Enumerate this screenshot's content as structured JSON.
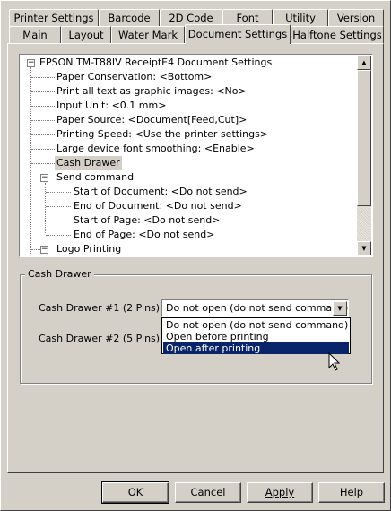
{
  "tabs_row1": [
    "Printer Settings",
    "Barcode",
    "2D Code",
    "Font",
    "Utility",
    "Version"
  ],
  "tabs_row2": [
    "Main",
    "Layout",
    "Water Mark",
    "Document Settings",
    "Halftone Settings"
  ],
  "active_tab": "Document Settings",
  "tree": {
    "root": "EPSON TM-T88IV ReceiptE4 Document Settings",
    "items": [
      "Paper Conservation: <Bottom>",
      "Print all text as graphic images: <No>",
      "Input Unit: <0.1 mm>",
      "Paper Source: <Document[Feed,Cut]>",
      "Printing Speed: <Use the printer settings>",
      "Large device font smoothing: <Enable>",
      "Cash Drawer",
      "Send command",
      "Start of Document: <Do not send>",
      "End of Document: <Do not send>",
      "Start of Page: <Do not send>",
      "End of Page: <Do not send>",
      "Logo Printing"
    ]
  },
  "cash_drawer": {
    "group_title": "Cash Drawer",
    "drawer1_label": "Cash Drawer #1 (2 Pins)",
    "drawer2_label": "Cash Drawer #2 (5 Pins)",
    "drawer1_value": "Do not open (do not send command)",
    "options": [
      "Do not open (do not send command)",
      "Open before printing",
      "Open after printing"
    ],
    "highlighted_option": "Open after printing"
  },
  "buttons": {
    "ok": "OK",
    "cancel": "Cancel",
    "apply": "Apply",
    "help": "Help"
  },
  "colors": {
    "dialog_bg": "#d4d0c8",
    "highlight": "#0a246a"
  }
}
